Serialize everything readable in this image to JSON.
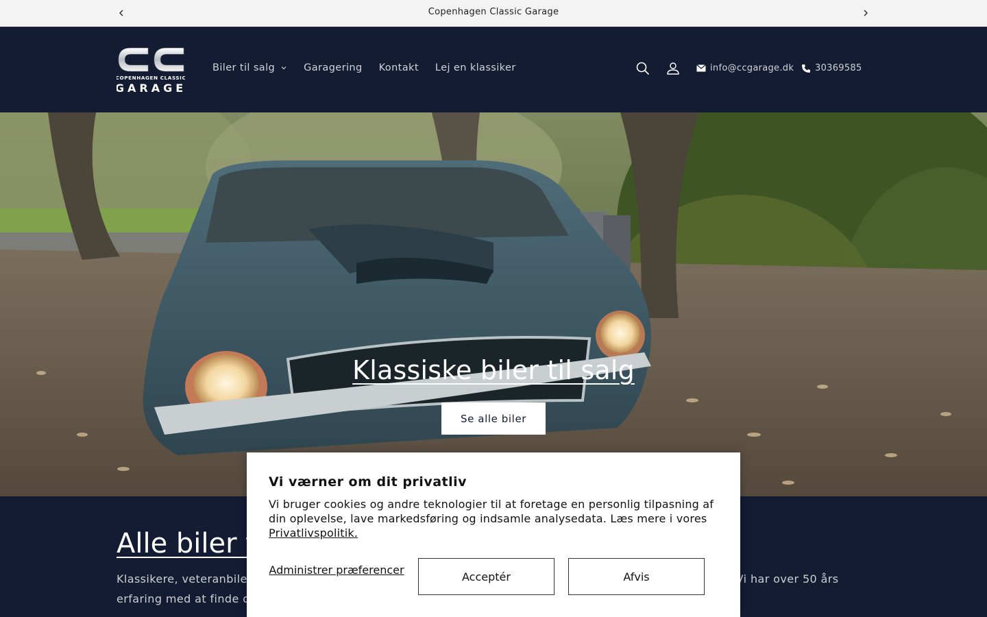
{
  "announcement": {
    "text": "Copenhagen Classic Garage",
    "prev_icon": "chevron-left-icon",
    "next_icon": "chevron-right-icon"
  },
  "header": {
    "logo": {
      "monogram": "CC",
      "tagline": "COPENHAGEN CLASSIC",
      "word": "GARAGE"
    },
    "nav": [
      {
        "label": "Biler til salg",
        "has_dropdown": true
      },
      {
        "label": "Garagering"
      },
      {
        "label": "Kontakt"
      },
      {
        "label": "Lej en klassiker"
      }
    ],
    "icons": [
      "search-icon",
      "account-icon"
    ],
    "email": "info@ccgarage.dk",
    "phone": "30369585"
  },
  "hero": {
    "title": "Klassiske biler til salg",
    "button": "Se alle biler"
  },
  "section": {
    "title": "Alle biler ti",
    "text_left": "Klassikere, veteranbiler",
    "text_right": ". Vi har over 50 års",
    "text_line2": "erfaring med at finde de"
  },
  "cookie": {
    "title": "Vi værner om dit privatliv",
    "body": "Vi bruger cookies og andre teknologier til at foretage en personlig tilpasning af din oplevelse, lave markedsføring og indsamle analysedata. Læs mere i vores",
    "link": "Privatlivspolitik.",
    "manage": "Administrer præferencer",
    "accept": "Acceptér",
    "decline": "Afvis"
  },
  "colors": {
    "navy": "#131c33",
    "announcement_bg": "#f3f3f3",
    "white": "#ffffff"
  }
}
